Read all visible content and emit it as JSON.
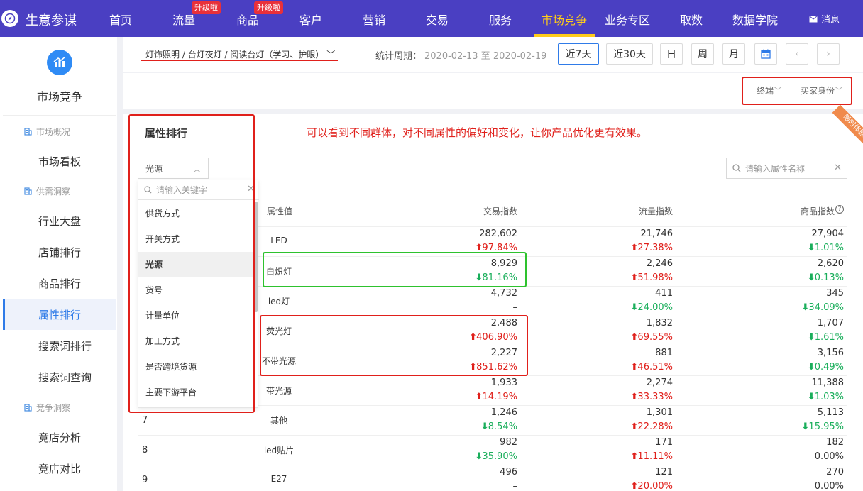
{
  "app": {
    "name": "生意参谋"
  },
  "nav": [
    {
      "label": "首页"
    },
    {
      "label": "流量",
      "badge": "升级啦"
    },
    {
      "label": "商品",
      "badge": "升级啦"
    },
    {
      "label": "客户"
    },
    {
      "label": "营销"
    },
    {
      "label": "交易"
    },
    {
      "label": "服务"
    },
    {
      "label": "市场竞争"
    },
    {
      "label": "业务专区"
    },
    {
      "label": "取数"
    },
    {
      "label": "数据学院"
    }
  ],
  "messages_label": "消息",
  "sidebar": {
    "title": "市场竞争",
    "groups": [
      {
        "label": "市场概况",
        "items": [
          "市场看板"
        ]
      },
      {
        "label": "供需洞察",
        "items": [
          "行业大盘",
          "店铺排行",
          "商品排行",
          "属性排行",
          "搜索词排行",
          "搜索词查询"
        ]
      },
      {
        "label": "竞争洞察",
        "items": [
          "竞店分析",
          "竞店对比"
        ]
      }
    ],
    "active": "属性排行"
  },
  "filters": {
    "category_path": "灯饰照明 / 台灯夜灯 / 阅读台灯（学习、护眼）",
    "period_label": "统计周期：",
    "period_range": "2020-02-13 至 2020-02-19",
    "buttons": [
      "近7天",
      "近30天",
      "日",
      "周",
      "月"
    ],
    "active_button": "近7天",
    "terminal": "终端",
    "buyer_identity": "买家身份"
  },
  "panel": {
    "title": "属性排行",
    "annotation": "可以看到不同群体，对不同属性的偏好和变化，让你产品优化更有效果。",
    "ribbon": "限时体验",
    "attribute_select": "光源",
    "attribute_search_placeholder": "请输入属性名称",
    "dropdown_search_placeholder": "请输入关键字",
    "dropdown_options": [
      "供货方式",
      "开关方式",
      "光源",
      "货号",
      "计量单位",
      "加工方式",
      "是否跨境货源",
      "主要下游平台"
    ],
    "selected_option": "光源"
  },
  "table": {
    "columns": [
      "属性值",
      "交易指数",
      "流量指数",
      "商品指数"
    ],
    "rows": [
      {
        "rank": "",
        "value": "LED",
        "trade": "282,602",
        "trade_chg": "97.84%",
        "trade_dir": "up",
        "flow": "21,746",
        "flow_chg": "27.38%",
        "flow_dir": "up",
        "goods": "27,904",
        "goods_chg": "1.01%",
        "goods_dir": "down"
      },
      {
        "rank": "",
        "value": "白炽灯",
        "trade": "8,929",
        "trade_chg": "81.16%",
        "trade_dir": "down",
        "flow": "2,246",
        "flow_chg": "51.98%",
        "flow_dir": "up",
        "goods": "2,620",
        "goods_chg": "0.13%",
        "goods_dir": "down"
      },
      {
        "rank": "",
        "value": "led灯",
        "trade": "4,732",
        "trade_chg": "–",
        "trade_dir": "none",
        "flow": "411",
        "flow_chg": "24.00%",
        "flow_dir": "down",
        "goods": "345",
        "goods_chg": "34.09%",
        "goods_dir": "down"
      },
      {
        "rank": "",
        "value": "荧光灯",
        "trade": "2,488",
        "trade_chg": "406.90%",
        "trade_dir": "up",
        "flow": "1,832",
        "flow_chg": "69.55%",
        "flow_dir": "up",
        "goods": "1,707",
        "goods_chg": "1.61%",
        "goods_dir": "down"
      },
      {
        "rank": "",
        "value": "不带光源",
        "trade": "2,227",
        "trade_chg": "851.62%",
        "trade_dir": "up",
        "flow": "881",
        "flow_chg": "46.51%",
        "flow_dir": "up",
        "goods": "3,156",
        "goods_chg": "0.49%",
        "goods_dir": "down"
      },
      {
        "rank": "",
        "value": "带光源",
        "trade": "1,933",
        "trade_chg": "14.19%",
        "trade_dir": "up",
        "flow": "2,274",
        "flow_chg": "33.33%",
        "flow_dir": "up",
        "goods": "11,388",
        "goods_chg": "1.03%",
        "goods_dir": "down"
      },
      {
        "rank": "7",
        "value": "其他",
        "trade": "1,246",
        "trade_chg": "8.54%",
        "trade_dir": "down",
        "flow": "1,301",
        "flow_chg": "22.28%",
        "flow_dir": "up",
        "goods": "5,113",
        "goods_chg": "15.95%",
        "goods_dir": "down"
      },
      {
        "rank": "8",
        "value": "led贴片",
        "trade": "982",
        "trade_chg": "35.90%",
        "trade_dir": "down",
        "flow": "171",
        "flow_chg": "11.11%",
        "flow_dir": "up",
        "goods": "182",
        "goods_chg": "0.00%",
        "goods_dir": "none"
      },
      {
        "rank": "9",
        "value": "E27",
        "trade": "496",
        "trade_chg": "–",
        "trade_dir": "none",
        "flow": "121",
        "flow_chg": "20.00%",
        "flow_dir": "up",
        "goods": "270",
        "goods_chg": "0.00%",
        "goods_dir": "none"
      }
    ]
  },
  "colors": {
    "nav_bg": "#4a3fc2",
    "accent": "#ffcc1a",
    "up": "#e0201b",
    "down": "#1aae5b",
    "highlight_red": "#e0201b",
    "highlight_green": "#2ec22e"
  }
}
